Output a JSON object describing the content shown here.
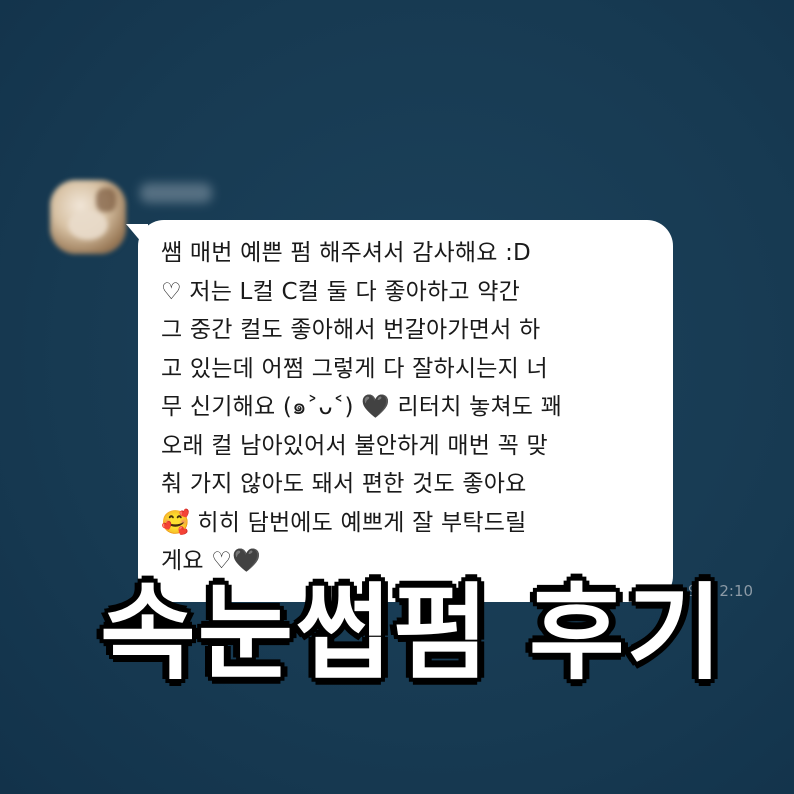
{
  "chat": {
    "message": {
      "lines": [
        "쌤 매번 예쁜 펌 해주셔서 감사해요 :D",
        "♡ 저는 L컬 C컬 둘 다 좋아하고 약간",
        "그 중간 컬도 좋아해서 번갈아가면서 하",
        "고 있는데 어쩜 그렇게 다 잘하시는지 너",
        "무 신기해요 (๑˃ᴗ˂) 🖤 리터치 놓쳐도 꽤",
        "오래 컬 남아있어서 불안하게 매번 꼭 맞",
        "춰 가지 않아도 돼서 편한 것도 좋아요",
        "🥰 히히 담번에도 예쁘게 잘 부탁드릴",
        "게요 ♡🖤"
      ]
    },
    "timestamp": "오후 2:10"
  },
  "overlay": {
    "headline": "속눈썹펌 후기"
  },
  "colors": {
    "background": "#173a52",
    "bubble": "#ffffff",
    "headline_text": "#ffffff",
    "headline_outline": "#000000"
  }
}
